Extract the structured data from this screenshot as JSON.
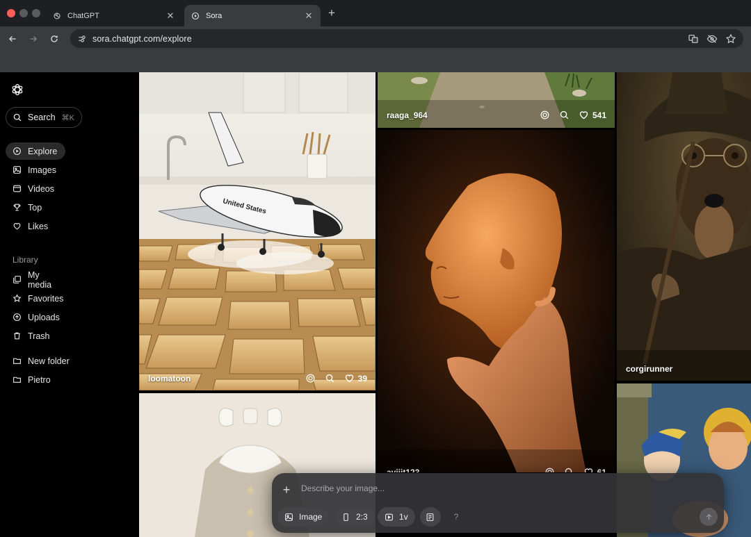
{
  "browser": {
    "tabs": [
      {
        "label": "ChatGPT",
        "icon": "chatgpt-logo-icon",
        "active": false
      },
      {
        "label": "Sora",
        "icon": "sora-logo-icon",
        "active": true
      }
    ],
    "close_glyph": "✕",
    "new_tab_glyph": "+",
    "url": "sora.chatgpt.com/explore"
  },
  "sidebar": {
    "search": {
      "label": "Search",
      "shortcut": "⌘K"
    },
    "nav": [
      {
        "label": "Explore",
        "icon": "explore-icon",
        "active": true
      },
      {
        "label": "Images",
        "icon": "images-icon"
      },
      {
        "label": "Videos",
        "icon": "videos-icon"
      },
      {
        "label": "Top",
        "icon": "trophy-icon"
      },
      {
        "label": "Likes",
        "icon": "heart-icon"
      }
    ],
    "library_label": "Library",
    "library": [
      {
        "label": "My media",
        "icon": "media-icon"
      },
      {
        "label": "Favorites",
        "icon": "star-icon"
      },
      {
        "label": "Uploads",
        "icon": "upload-icon"
      },
      {
        "label": "Trash",
        "icon": "trash-icon"
      }
    ],
    "folders": [
      {
        "label": "New folder",
        "icon": "folder-icon"
      },
      {
        "label": "Pietro",
        "icon": "folder-icon"
      }
    ]
  },
  "feed": {
    "cards": [
      {
        "user": "loomatoon",
        "likes": "39",
        "subject": "space shuttle over toast"
      },
      {
        "user": "raaga_964",
        "likes": "541",
        "subject": "dirt path"
      },
      {
        "user": "corgirunner",
        "likes": "",
        "subject": "dog wizard portrait"
      },
      {
        "user": "aviiit123",
        "likes": "61",
        "subject": "hand holding face mask"
      },
      {
        "user": "",
        "likes": "",
        "subject": "tweed jacket with bow"
      },
      {
        "user": "",
        "likes": "",
        "subject": "painted characters"
      }
    ]
  },
  "composer": {
    "plus": "+",
    "placeholder": "Describe your image...",
    "chips": {
      "type": "Image",
      "ratio": "2:3",
      "variations": "1v",
      "help": "?"
    }
  },
  "colors": {
    "background": "#000000",
    "chrome": "#3a3b3e",
    "tabbar": "#1e1f22",
    "composer": "#343437"
  }
}
